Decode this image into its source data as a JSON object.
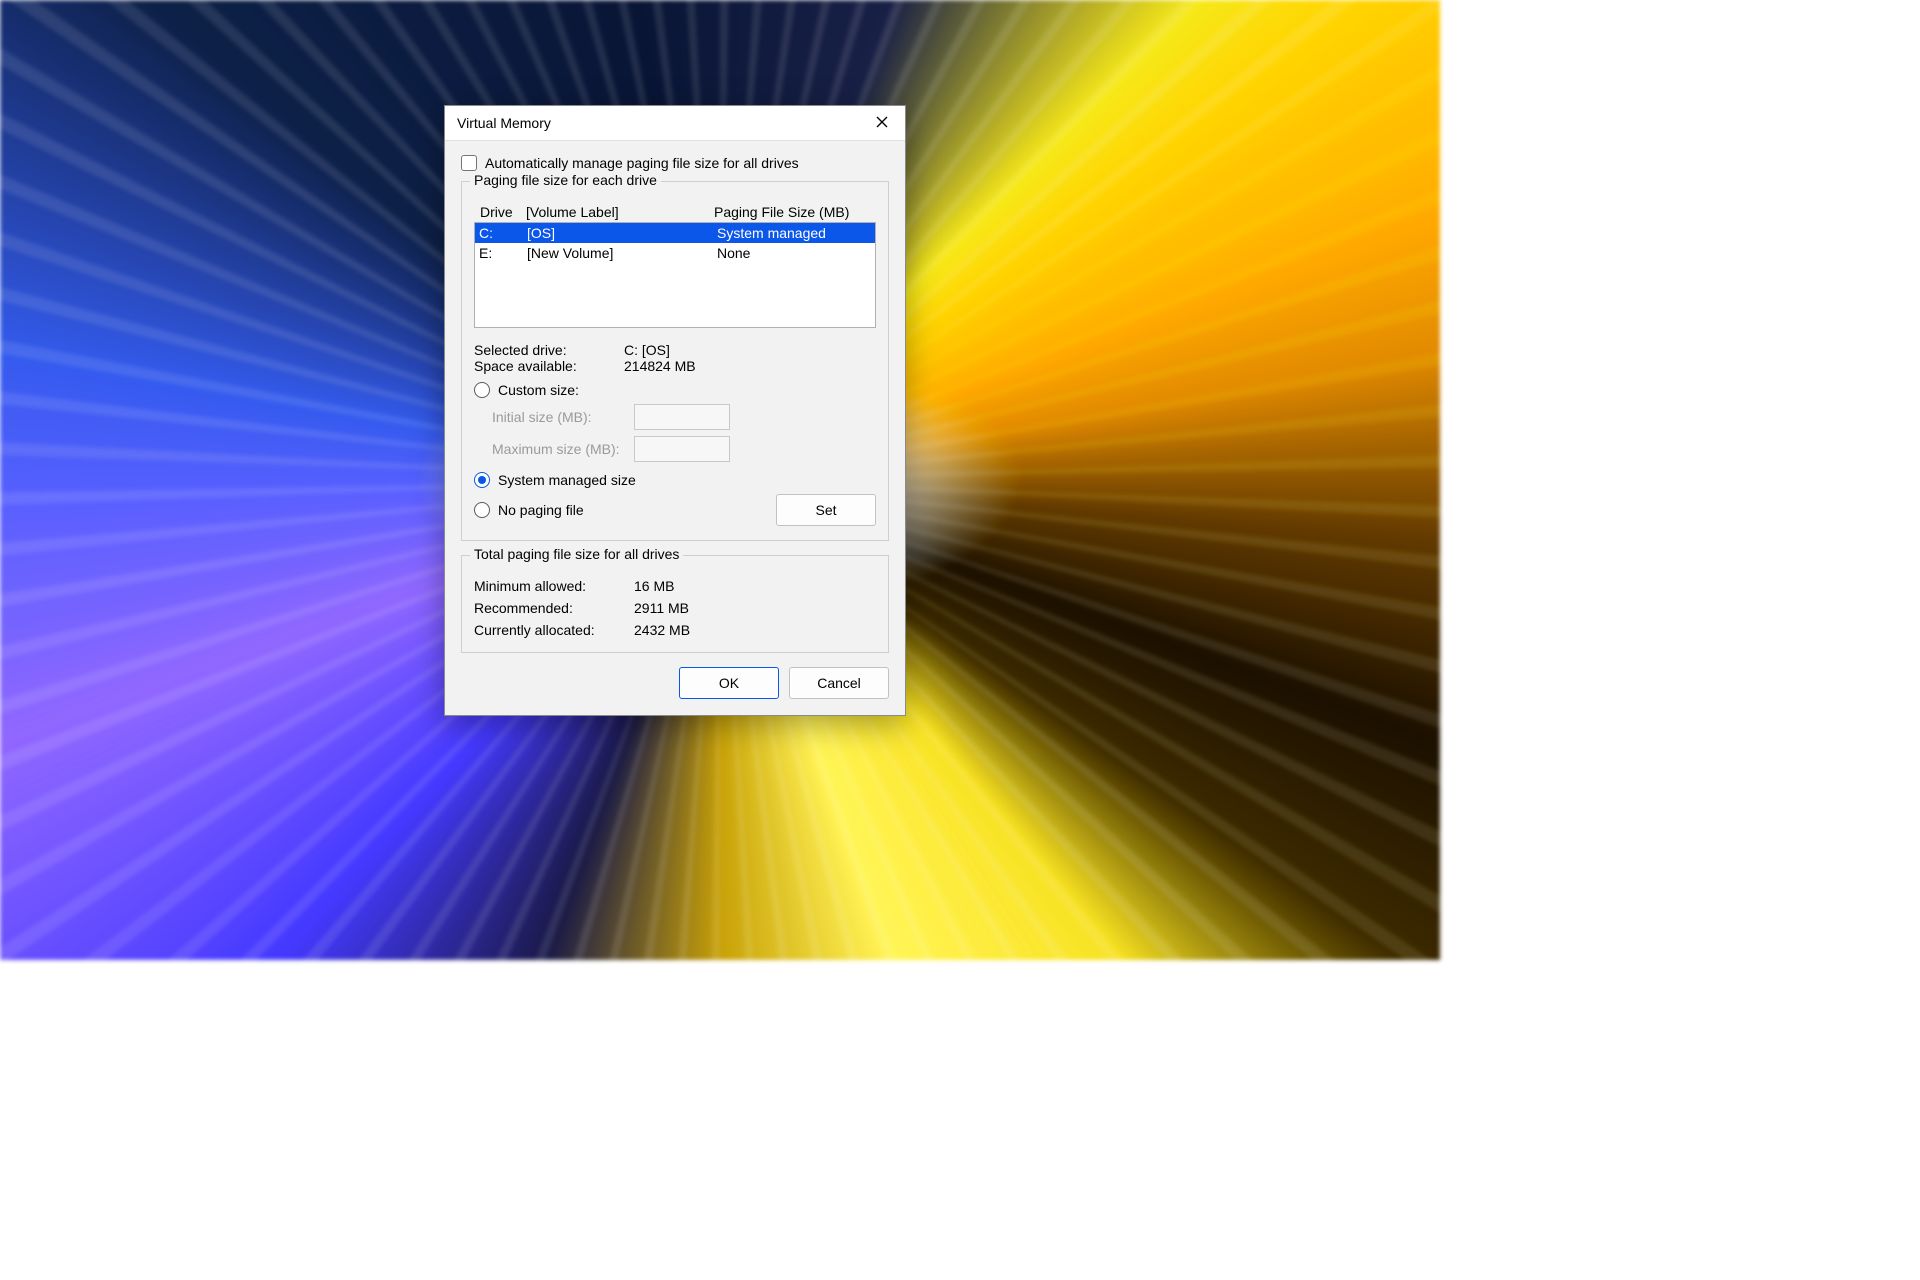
{
  "window": {
    "title": "Virtual Memory",
    "close_icon_name": "close-icon"
  },
  "auto_manage": {
    "label": "Automatically manage paging file size for all drives",
    "checked": false
  },
  "per_drive_group": {
    "title": "Paging file size for each drive",
    "headers": {
      "drive": "Drive",
      "volume": "[Volume Label]",
      "pfs": "Paging File Size (MB)"
    },
    "drives": [
      {
        "letter": "C:",
        "volume": "[OS]",
        "pfs": "System managed",
        "selected": true
      },
      {
        "letter": "E:",
        "volume": "[New Volume]",
        "pfs": "None",
        "selected": false
      }
    ],
    "selected_drive_label": "Selected drive:",
    "selected_drive_value": "C:  [OS]",
    "space_available_label": "Space available:",
    "space_available_value": "214824 MB",
    "custom_size_label": "Custom size:",
    "initial_size_label": "Initial size (MB):",
    "initial_size_value": "",
    "maximum_size_label": "Maximum size (MB):",
    "maximum_size_value": "",
    "system_managed_label": "System managed size",
    "no_paging_label": "No paging file",
    "set_button": "Set",
    "radio_selected": "system"
  },
  "totals_group": {
    "title": "Total paging file size for all drives",
    "minimum_label": "Minimum allowed:",
    "minimum_value": "16 MB",
    "recommended_label": "Recommended:",
    "recommended_value": "2911 MB",
    "current_label": "Currently allocated:",
    "current_value": "2432 MB"
  },
  "buttons": {
    "ok": "OK",
    "cancel": "Cancel"
  }
}
